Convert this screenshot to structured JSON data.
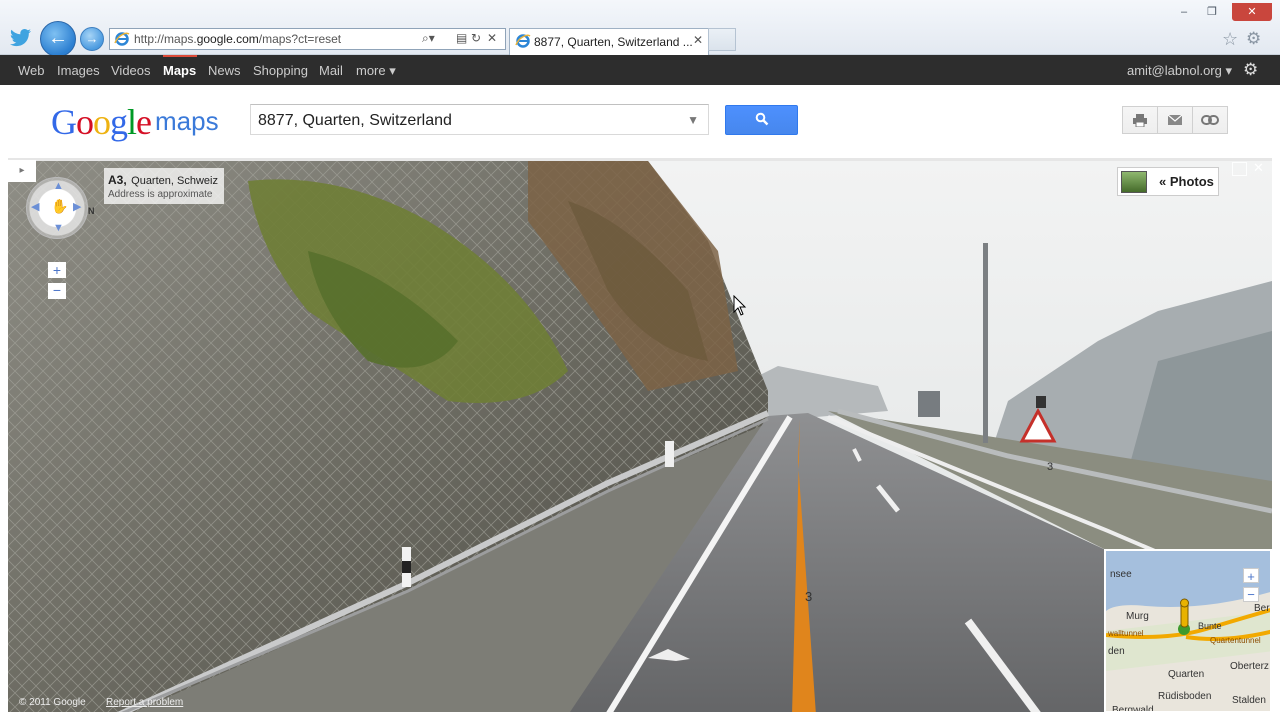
{
  "browser": {
    "url_prefix": "http://maps.",
    "url_domain": "google.com",
    "url_path": "/maps?ct=reset",
    "tab_title": "8877, Quarten, Switzerland ...",
    "window_controls": [
      "–",
      "❐",
      "✕"
    ]
  },
  "gbar": {
    "items": [
      "Web",
      "Images",
      "Videos",
      "Maps",
      "News",
      "Shopping",
      "Mail",
      "more ▾"
    ],
    "active": "Maps",
    "account": "amit@labnol.org ▾"
  },
  "header": {
    "logo_google": "Google",
    "logo_maps": "maps",
    "search_value": "8877, Quarten, Switzerland"
  },
  "streetview": {
    "road": "A3,",
    "place": "Quarten, Schweiz",
    "approx": "Address is approximate",
    "compass": "N",
    "photos_label": "« Photos",
    "copyright": "© 2011 Google",
    "report": "Report a problem",
    "road_number_left": "3",
    "road_number_sign": "3"
  },
  "minimap": {
    "labels": [
      "nsee",
      "Murg",
      "Bunte",
      "Quartentunnel",
      "walltunnel",
      "Quarten",
      "Oberterz",
      "den",
      "Rüdisboden",
      "Stalden",
      "Bergwald",
      "Ber"
    ]
  },
  "colors": {
    "accent_blue": "#4d90fe",
    "gbar_bg": "#2d2d2d",
    "active_red": "#dd4b39"
  }
}
